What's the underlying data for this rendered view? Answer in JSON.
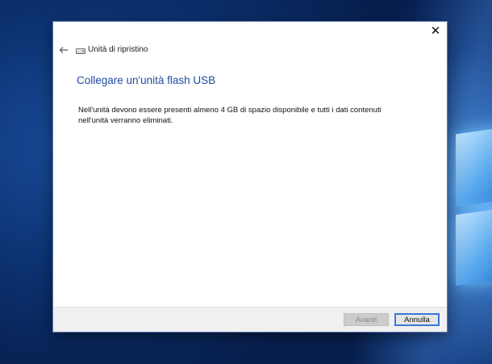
{
  "dialog": {
    "nav_title": "Unità di ripristino",
    "heading": "Collegare un'unità flash USB",
    "body_line1": "Nell'unità devono essere presenti almeno 4 GB di spazio disponibile e tutti i dati contenuti",
    "body_line2": "nell'unità verranno eliminati.",
    "next_label": "Avanti",
    "cancel_label": "Annulla",
    "close_glyph": "✕"
  },
  "icons": {
    "back": "back-arrow-icon",
    "drive": "drive-icon",
    "close": "close-icon"
  },
  "colors": {
    "heading": "#1e4ba0",
    "cancel_border": "#3b78d8",
    "footer_bg": "#f0f0f0"
  }
}
